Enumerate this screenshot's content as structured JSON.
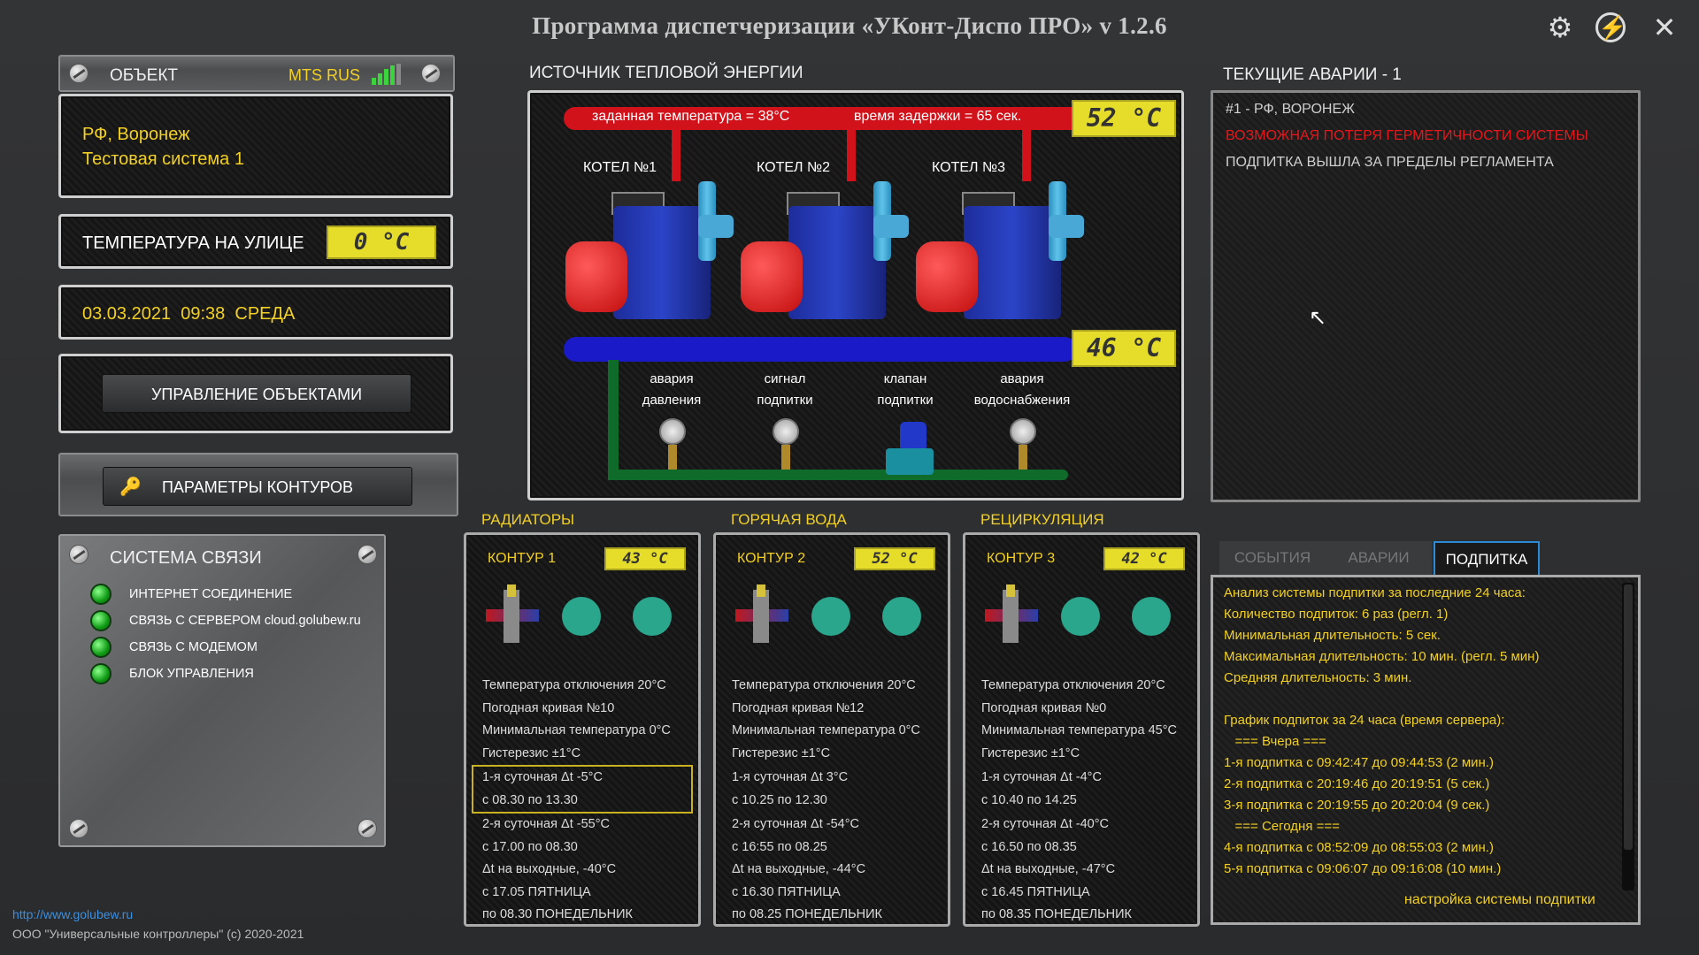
{
  "window": {
    "title": "Программа диспетчеризации «УКонт-Диспо ПРО» v 1.2.6"
  },
  "object": {
    "header": "ОБЪЕКТ",
    "operator": "MTS RUS",
    "line1": "РФ, Воронеж",
    "line2": "Тестовая система 1"
  },
  "outdoor": {
    "label": "ТЕМПЕРАТУРА НА УЛИЦЕ",
    "value": "0 °C"
  },
  "datetime": {
    "text": "03.03.2021  09:38  СРЕДА"
  },
  "buttons": {
    "manage": "УПРАВЛЕНИЕ ОБЪЕКТАМИ",
    "params": "ПАРАМЕТРЫ КОНТУРОВ",
    "podpitka_settings": "настройка системы подпитки"
  },
  "comm": {
    "title": "СИСТЕМА СВЯЗИ",
    "items": [
      "ИНТЕРНЕТ СОЕДИНЕНИЕ",
      "СВЯЗЬ С СЕРВЕРОМ cloud.golubew.ru",
      "СВЯЗЬ С МОДЕМОМ",
      "БЛОК УПРАВЛЕНИЯ"
    ]
  },
  "footer": {
    "url": "http://www.golubew.ru",
    "copyright": "ООО \"Универсальные контроллеры\" (c) 2020-2021"
  },
  "source": {
    "title": "ИСТОЧНИК ТЕПЛОВОЙ ЭНЕРГИИ",
    "set_temp": "заданная температура = 38°C",
    "delay": "время задержки = 65 сек.",
    "supply_temp": "52 °C",
    "return_temp": "46 °C",
    "boilers": [
      "КОТЕЛ №1",
      "КОТЕЛ №2",
      "КОТЕЛ №3"
    ],
    "sensors": [
      {
        "l1": "авария",
        "l2": "давления"
      },
      {
        "l1": "сигнал",
        "l2": "подпитки"
      },
      {
        "l1": "клапан",
        "l2": "подпитки"
      },
      {
        "l1": "авария",
        "l2": "водоснабжения"
      }
    ]
  },
  "alarms": {
    "title": "ТЕКУЩИЕ АВАРИИ - 1",
    "items": [
      {
        "text": "#1 - РФ, ВОРОНЕЖ",
        "color": "#d0d0d0"
      },
      {
        "text": "ВОЗМОЖНАЯ ПОТЕРЯ ГЕРМЕТИЧНОСТИ СИСТЕМЫ",
        "color": "#e8161a"
      },
      {
        "text": "ПОДПИТКА ВЫШЛА ЗА ПРЕДЕЛЫ РЕГЛАМЕНТА",
        "color": "#d0d0d0"
      }
    ]
  },
  "circuits": [
    {
      "section": "РАДИАТОРЫ",
      "name": "КОНТУР 1",
      "temp": "43 °C",
      "rows": [
        "Температура отключения 20°C",
        "Погодная кривая №10",
        "Минимальная температура 0°C",
        "Гистерезис ±1°C",
        "1-я суточная Δt -5°C",
        "с 08.30 по 13.30",
        "2-я суточная Δt -55°C",
        "с 17.00 по 08.30",
        "Δt на выходные, -40°C",
        "с 17.05 ПЯТНИЦА",
        "по 08.30 ПОНЕДЕЛЬНИК"
      ]
    },
    {
      "section": "ГОРЯЧАЯ ВОДА",
      "name": "КОНТУР 2",
      "temp": "52 °C",
      "rows": [
        "Температура отключения 20°C",
        "Погодная кривая №12",
        "Минимальная температура 0°C",
        "Гистерезис ±1°C",
        "1-я суточная Δt 3°C",
        "с 10.25 по 12.30",
        "2-я суточная Δt -54°C",
        "с 16:55 по 08.25",
        "Δt на выходные, -44°C",
        "с 16.30 ПЯТНИЦА",
        "по 08.25 ПОНЕДЕЛЬНИК"
      ]
    },
    {
      "section": "РЕЦИРКУЛЯЦИЯ",
      "name": "КОНТУР 3",
      "temp": "42 °C",
      "rows": [
        "Температура отключения 20°C",
        "Погодная кривая №0",
        "Минимальная температура 45°C",
        "Гистерезис ±1°C",
        "1-я суточная Δt -4°C",
        "с 10.40 по 14.25",
        "2-я суточная Δt -40°C",
        "с 16.50 по 08.35",
        "Δt на выходные, -47°C",
        "с 16.45 ПЯТНИЦА",
        "по 08.35 ПОНЕДЕЛЬНИК"
      ]
    }
  ],
  "tabs": [
    "СОБЫТИЯ",
    "АВАРИИ",
    "ПОДПИТКА"
  ],
  "podpitka": {
    "lines": [
      "Анализ системы подпитки за последние 24 часа:",
      "Количество подпиток: 6 раз (регл. 1)",
      "Минимальная длительность: 5 сек.",
      "Максимальная длительность: 10 мин. (регл. 5 мин)",
      "Средняя длительность: 3 мин.",
      "",
      "График подпиток за 24 часа (время сервера):",
      "   === Вчера ===",
      "1-я подпитка с 09:42:47 до 09:44:53 (2 мин.)",
      "2-я подпитка с 20:19:46 до 20:19:51 (5 сек.)",
      "3-я подпитка с 20:19:55 до 20:20:04 (9 сек.)",
      "   === Сегодня ===",
      "4-я подпитка с 08:52:09 до 08:55:03 (2 мин.)",
      "5-я подпитка с 09:06:07 до 09:16:08 (10 мин.)"
    ]
  },
  "colors": {
    "accent_yellow": "#f2d025",
    "alarm_red": "#e8161a",
    "supply_red": "#d1121a",
    "return_blue": "#1a1ac8",
    "makeup_green": "#0f6b2a"
  }
}
